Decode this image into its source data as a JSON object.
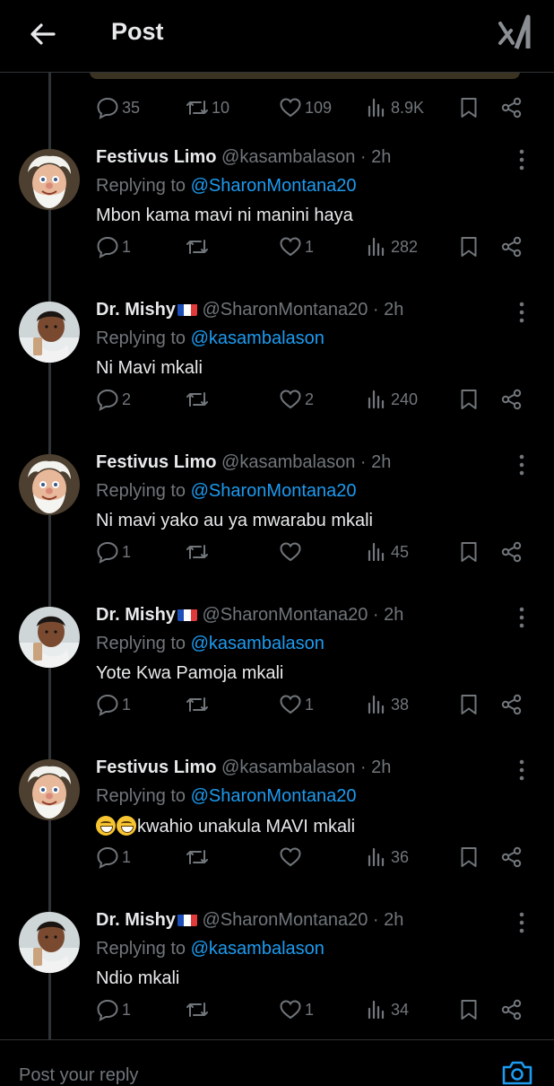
{
  "header": {
    "title": "Post",
    "back_icon": "arrow-left-icon",
    "logo_icon": "x-logo-icon"
  },
  "colors": {
    "background": "#000000",
    "text": "#e7e9ea",
    "muted": "#71767b",
    "link": "#1d9bf0",
    "divider": "#2f3336"
  },
  "main_post_actions": {
    "replies": "35",
    "reposts": "10",
    "likes": "109",
    "views": "8.9K"
  },
  "replies": [
    {
      "name": "Festivus Limo",
      "flag": false,
      "handle": "@kasambalason",
      "time": "· 2h",
      "replying_prefix": "Replying to ",
      "replying_to": "@SharonMontana20",
      "text": "Mbon kama mavi ni manini haya",
      "emoji": "",
      "comments": "1",
      "reposts": "",
      "likes": "1",
      "views": "282"
    },
    {
      "name": "Dr. Mishy",
      "flag": true,
      "handle": "@SharonMontana20",
      "time": "· 2h",
      "replying_prefix": "Replying to ",
      "replying_to": "@kasambalason",
      "text": "Ni Mavi mkali",
      "emoji": "",
      "comments": "2",
      "reposts": "",
      "likes": "2",
      "views": "240"
    },
    {
      "name": "Festivus Limo",
      "flag": false,
      "handle": "@kasambalason",
      "time": "· 2h",
      "replying_prefix": "Replying to ",
      "replying_to": "@SharonMontana20",
      "text": "Ni mavi yako au ya mwarabu mkali",
      "emoji": "",
      "comments": "1",
      "reposts": "",
      "likes": "",
      "views": "45"
    },
    {
      "name": "Dr. Mishy",
      "flag": true,
      "handle": "@SharonMontana20",
      "time": "· 2h",
      "replying_prefix": "Replying to ",
      "replying_to": "@kasambalason",
      "text": "Yote Kwa Pamoja mkali",
      "emoji": "",
      "comments": "1",
      "reposts": "",
      "likes": "1",
      "views": "38"
    },
    {
      "name": "Festivus Limo",
      "flag": false,
      "handle": "@kasambalason",
      "time": "· 2h",
      "replying_prefix": "Replying to ",
      "replying_to": "@SharonMontana20",
      "text": "kwahio unakula MAVI mkali",
      "emoji": "😄😄",
      "comments": "1",
      "reposts": "",
      "likes": "",
      "views": "36"
    },
    {
      "name": "Dr. Mishy",
      "flag": true,
      "handle": "@SharonMontana20",
      "time": "· 2h",
      "replying_prefix": "Replying to ",
      "replying_to": "@kasambalason",
      "text": "Ndio mkali",
      "emoji": "",
      "comments": "1",
      "reposts": "",
      "likes": "1",
      "views": "34"
    }
  ],
  "composer": {
    "placeholder": "Post your reply",
    "camera_icon": "camera-icon"
  }
}
